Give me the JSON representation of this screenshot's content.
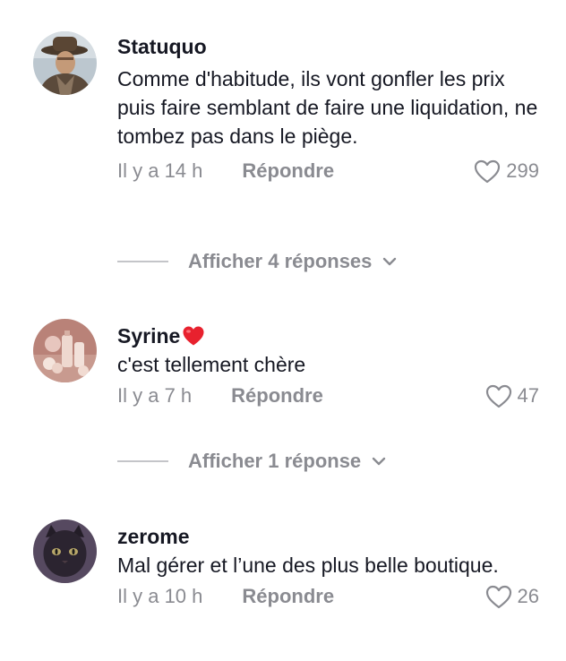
{
  "comments": [
    {
      "username": "Statuquo",
      "text": "Comme d'habitude, ils vont gonfler les prix puis faire semblant de faire une liquidation, ne tombez pas dans le piège.",
      "time": "Il y a 14 h",
      "reply_label": "Répondre",
      "likes": "299",
      "avatar_icon": "cowboy-portrait",
      "view_replies": "Afficher 4 réponses"
    },
    {
      "username": "Syrine",
      "username_emoji": "red-heart-emoji",
      "text": "c'est tellement chère",
      "time": "Il y a 7 h",
      "reply_label": "Répondre",
      "likes": "47",
      "avatar_icon": "pink-cosmetics",
      "view_replies": "Afficher 1 réponse"
    },
    {
      "username": "zerome",
      "text": "Mal gérer et l’une des plus belle boutique.",
      "time": "Il y a 10 h",
      "reply_label": "Répondre",
      "likes": "26",
      "avatar_icon": "black-cat"
    }
  ],
  "colors": {
    "text_primary": "#161823",
    "text_secondary": "#8a8b91",
    "divider": "#c4c5c9",
    "heart_emoji": "#e8212e"
  }
}
